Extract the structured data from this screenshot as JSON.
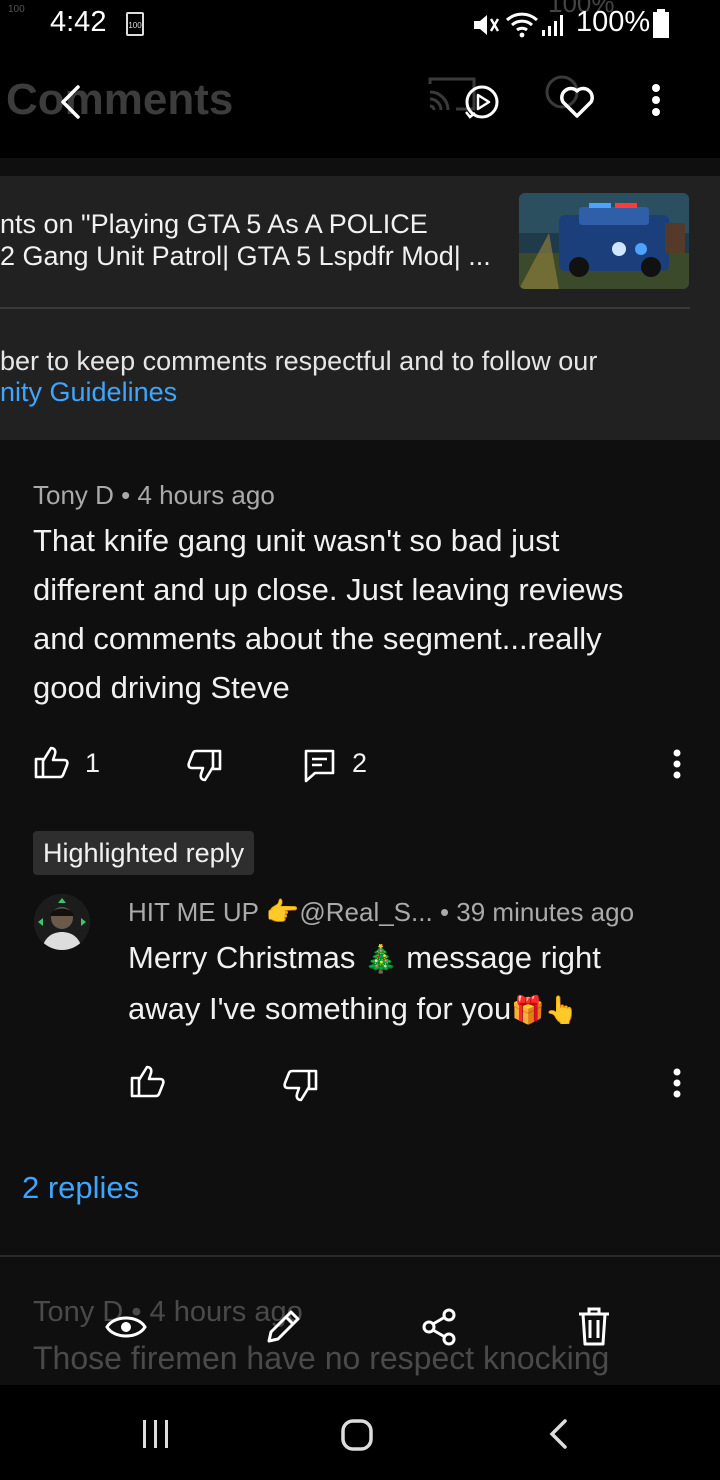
{
  "status_bar": {
    "time": "4:42",
    "small_battery": "100",
    "battery_percent": "100%",
    "ghost_battery_percent": "100%",
    "ghost_tiny": "100"
  },
  "header": {
    "ghost_title": "Comments",
    "icons": [
      "back-icon",
      "cast-icon",
      "autoplay-icon",
      "heart-icon",
      "more-vertical-icon"
    ]
  },
  "video_panel": {
    "title_line1": "nts on \"Playing GTA 5 As A POLICE",
    "title_line2": "2 Gang Unit Patrol|  GTA 5 Lspdfr Mod| ...",
    "notice_line": "ber to keep comments respectful and to follow our",
    "guidelines_link": "nity Guidelines"
  },
  "comment": {
    "author": "Tony D",
    "time": "4 hours ago",
    "text_lines": [
      "That knife gang unit wasn't so bad just",
      "different and up close. Just leaving reviews",
      "and comments about the segment...really",
      "good driving Steve"
    ],
    "likes": "1",
    "reply_count": "2"
  },
  "highlighted_reply": {
    "badge": "Highlighted reply",
    "author_prefix": "HIT ME UP ",
    "author_handle": "@Real_S...",
    "time": "39 minutes ago",
    "line1_a": "Merry Christmas ",
    "line1_b": " message right",
    "line2": "away I've something for you",
    "emojis": {
      "pointing": "👉",
      "tree": "🎄",
      "gift": "🎁",
      "pointing_down": "👆"
    }
  },
  "replies_link": "2 replies",
  "next_comment": {
    "author": "Tony D",
    "time": "4 hours ago",
    "text": "Those firemen have no respect knocking"
  },
  "selection_toolbar": {
    "icons": [
      "eye-icon",
      "pencil-icon",
      "share-icon",
      "trash-icon"
    ]
  },
  "nav_bar": {
    "icons": [
      "recent-apps-icon",
      "home-icon",
      "back-nav-icon"
    ]
  },
  "colors": {
    "background": "#0f0f0f",
    "panel": "#212121",
    "link": "#3ea6ff",
    "meta": "#aaaaaa"
  }
}
